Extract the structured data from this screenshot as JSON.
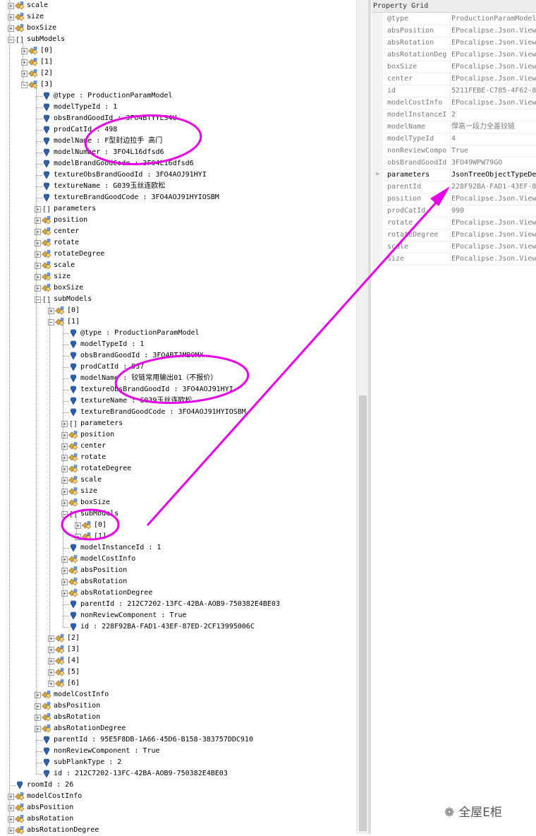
{
  "tree_rows": [
    {
      "d": 0,
      "exp": "+",
      "icon": "obj",
      "t": "scale"
    },
    {
      "d": 0,
      "exp": "+",
      "icon": "obj",
      "t": "size"
    },
    {
      "d": 0,
      "exp": "+",
      "icon": "obj",
      "t": "boxSize"
    },
    {
      "d": 0,
      "exp": "-",
      "icon": "arr",
      "t": "subModels"
    },
    {
      "d": 1,
      "exp": "+",
      "icon": "obj",
      "t": "[0]"
    },
    {
      "d": 1,
      "exp": "+",
      "icon": "obj",
      "t": "[1]"
    },
    {
      "d": 1,
      "exp": "+",
      "icon": "obj",
      "t": "[2]"
    },
    {
      "d": 1,
      "exp": "-",
      "icon": "obj",
      "t": "[3]"
    },
    {
      "d": 2,
      "exp": "",
      "icon": "val",
      "t": "@type : ProductionParamModel"
    },
    {
      "d": 2,
      "exp": "",
      "icon": "val",
      "t": "modelTypeId : 1"
    },
    {
      "d": 2,
      "exp": "",
      "icon": "val",
      "t": "obsBrandGoodId : 3FO4BTYYLS4U"
    },
    {
      "d": 2,
      "exp": "",
      "icon": "val",
      "t": "prodCatId : 498"
    },
    {
      "d": 2,
      "exp": "",
      "icon": "val",
      "t": "modelName : F型封边拉手 高门"
    },
    {
      "d": 2,
      "exp": "",
      "icon": "val",
      "t": "modelNumber : 3FO4L16dfsd6"
    },
    {
      "d": 2,
      "exp": "",
      "icon": "val",
      "t": "modelBrandGoodCode : 3FO4L16dfsd6"
    },
    {
      "d": 2,
      "exp": "",
      "icon": "val",
      "t": "textureObsBrandGoodId : 3FO4AOJ91HYI"
    },
    {
      "d": 2,
      "exp": "",
      "icon": "val",
      "t": "textureName : G039玉丝连欧松"
    },
    {
      "d": 2,
      "exp": "",
      "icon": "val",
      "t": "textureBrandGoodCode : 3FO4AOJ91HYIOSBM"
    },
    {
      "d": 2,
      "exp": "+",
      "icon": "arr",
      "t": "parameters"
    },
    {
      "d": 2,
      "exp": "+",
      "icon": "obj",
      "t": "position"
    },
    {
      "d": 2,
      "exp": "+",
      "icon": "obj",
      "t": "center"
    },
    {
      "d": 2,
      "exp": "+",
      "icon": "obj",
      "t": "rotate"
    },
    {
      "d": 2,
      "exp": "+",
      "icon": "obj",
      "t": "rotateDegree"
    },
    {
      "d": 2,
      "exp": "+",
      "icon": "obj",
      "t": "scale"
    },
    {
      "d": 2,
      "exp": "+",
      "icon": "obj",
      "t": "size"
    },
    {
      "d": 2,
      "exp": "+",
      "icon": "obj",
      "t": "boxSize"
    },
    {
      "d": 2,
      "exp": "-",
      "icon": "arr",
      "t": "subModels"
    },
    {
      "d": 3,
      "exp": "+",
      "icon": "obj",
      "t": "[0]"
    },
    {
      "d": 3,
      "exp": "-",
      "icon": "obj",
      "t": "[1]"
    },
    {
      "d": 4,
      "exp": "",
      "icon": "val",
      "t": "@type : ProductionParamModel"
    },
    {
      "d": 4,
      "exp": "",
      "icon": "val",
      "t": "modelTypeId : 1"
    },
    {
      "d": 4,
      "exp": "",
      "icon": "val",
      "t": "obsBrandGoodId : 3FO4BTJMBOMX"
    },
    {
      "d": 4,
      "exp": "",
      "icon": "val",
      "t": "prodCatId : 957"
    },
    {
      "d": 4,
      "exp": "",
      "icon": "val",
      "t": "modelName : 铰链常用输出01（不报价）"
    },
    {
      "d": 4,
      "exp": "",
      "icon": "val",
      "t": "textureObsBrandGoodId : 3FO4AOJ91HYI"
    },
    {
      "d": 4,
      "exp": "",
      "icon": "val",
      "t": "textureName : G039玉丝连欧松"
    },
    {
      "d": 4,
      "exp": "",
      "icon": "val",
      "t": "textureBrandGoodCode : 3FO4AOJ91HYIOSBM"
    },
    {
      "d": 4,
      "exp": "+",
      "icon": "arr",
      "t": "parameters"
    },
    {
      "d": 4,
      "exp": "+",
      "icon": "obj",
      "t": "position"
    },
    {
      "d": 4,
      "exp": "+",
      "icon": "obj",
      "t": "center"
    },
    {
      "d": 4,
      "exp": "+",
      "icon": "obj",
      "t": "rotate"
    },
    {
      "d": 4,
      "exp": "+",
      "icon": "obj",
      "t": "rotateDegree"
    },
    {
      "d": 4,
      "exp": "+",
      "icon": "obj",
      "t": "scale"
    },
    {
      "d": 4,
      "exp": "+",
      "icon": "obj",
      "t": "size"
    },
    {
      "d": 4,
      "exp": "+",
      "icon": "obj",
      "t": "boxSize"
    },
    {
      "d": 4,
      "exp": "-",
      "icon": "arr",
      "t": "subModels"
    },
    {
      "d": 5,
      "exp": "+",
      "icon": "obj",
      "t": "[0]"
    },
    {
      "d": 5,
      "exp": "+",
      "icon": "obj",
      "t": "[1]"
    },
    {
      "d": 4,
      "exp": "",
      "icon": "val",
      "t": "modelInstanceId : 1"
    },
    {
      "d": 4,
      "exp": "+",
      "icon": "obj",
      "t": "modelCostInfo"
    },
    {
      "d": 4,
      "exp": "+",
      "icon": "obj",
      "t": "absPosition"
    },
    {
      "d": 4,
      "exp": "+",
      "icon": "obj",
      "t": "absRotation"
    },
    {
      "d": 4,
      "exp": "+",
      "icon": "obj",
      "t": "absRotationDegree"
    },
    {
      "d": 4,
      "exp": "",
      "icon": "val",
      "t": "parentId : 212C7202-13FC-42BA-AOB9-750382E4BE03"
    },
    {
      "d": 4,
      "exp": "",
      "icon": "val",
      "t": "nonReviewComponent : True"
    },
    {
      "d": 4,
      "exp": "",
      "icon": "val",
      "t": "id : 228F92BA-FAD1-43EF-87ED-2CF13995006C"
    },
    {
      "d": 3,
      "exp": "+",
      "icon": "obj",
      "t": "[2]"
    },
    {
      "d": 3,
      "exp": "+",
      "icon": "obj",
      "t": "[3]"
    },
    {
      "d": 3,
      "exp": "+",
      "icon": "obj",
      "t": "[4]"
    },
    {
      "d": 3,
      "exp": "+",
      "icon": "obj",
      "t": "[5]"
    },
    {
      "d": 3,
      "exp": "+",
      "icon": "obj",
      "t": "[6]"
    },
    {
      "d": 2,
      "exp": "+",
      "icon": "obj",
      "t": "modelCostInfo"
    },
    {
      "d": 2,
      "exp": "+",
      "icon": "obj",
      "t": "absPosition"
    },
    {
      "d": 2,
      "exp": "+",
      "icon": "obj",
      "t": "absRotation"
    },
    {
      "d": 2,
      "exp": "+",
      "icon": "obj",
      "t": "absRotationDegree"
    },
    {
      "d": 2,
      "exp": "",
      "icon": "val",
      "t": "parentId : 95E5F8DB-1A66-45D6-B158-383757DDC910"
    },
    {
      "d": 2,
      "exp": "",
      "icon": "val",
      "t": "nonReviewComponent : True"
    },
    {
      "d": 2,
      "exp": "",
      "icon": "val",
      "t": "subPlankType : 2"
    },
    {
      "d": 2,
      "exp": "",
      "icon": "val",
      "t": "id : 212C7202-13FC-42BA-AOB9-750382E4BE03"
    },
    {
      "d": 0,
      "exp": "",
      "icon": "val",
      "t": "roomId : 26"
    },
    {
      "d": 0,
      "exp": "+",
      "icon": "obj",
      "t": "modelCostInfo"
    },
    {
      "d": 0,
      "exp": "+",
      "icon": "obj",
      "t": "absPosition"
    },
    {
      "d": 0,
      "exp": "+",
      "icon": "obj",
      "t": "absRotation"
    },
    {
      "d": 0,
      "exp": "+",
      "icon": "obj",
      "t": "absRotationDegree"
    }
  ],
  "property_grid": {
    "title": "Property Grid",
    "rows": [
      {
        "k": "@type",
        "v": "ProductionParamModel",
        "bold": false,
        "exp": ""
      },
      {
        "k": "absPosition",
        "v": "EPocalipse.Json.Viewer",
        "bold": false,
        "exp": ""
      },
      {
        "k": "absRotation",
        "v": "EPocalipse.Json.Viewer",
        "bold": false,
        "exp": ""
      },
      {
        "k": "absRotationDeg",
        "v": "EPocalipse.Json.Viewer",
        "bold": false,
        "exp": ""
      },
      {
        "k": "boxSize",
        "v": "EPocalipse.Json.Viewer",
        "bold": false,
        "exp": ""
      },
      {
        "k": "center",
        "v": "EPocalipse.Json.Viewer",
        "bold": false,
        "exp": ""
      },
      {
        "k": "id",
        "v": "5211FEBE-C785-4F62-8",
        "bold": false,
        "exp": ""
      },
      {
        "k": "modelCostInfo",
        "v": "EPocalipse.Json.Viewer",
        "bold": false,
        "exp": ""
      },
      {
        "k": "modelInstanceI",
        "v": "2",
        "bold": false,
        "exp": ""
      },
      {
        "k": "modelName",
        "v": "悍高一段力全盖铰链",
        "bold": false,
        "exp": ""
      },
      {
        "k": "modelTypeId",
        "v": "4",
        "bold": false,
        "exp": ""
      },
      {
        "k": "nonReviewCompo",
        "v": "True",
        "bold": false,
        "exp": ""
      },
      {
        "k": "obsBrandGoodId",
        "v": "3FO49WPW79GO",
        "bold": false,
        "exp": ""
      },
      {
        "k": "parameters",
        "v": "JsonTreeObjectTypeDe",
        "bold": true,
        "exp": ">"
      },
      {
        "k": "parentId",
        "v": "228F92BA-FAD1-43EF-8",
        "bold": false,
        "exp": ""
      },
      {
        "k": "position",
        "v": "EPocalipse.Json.Viewer",
        "bold": false,
        "exp": ""
      },
      {
        "k": "prodCatId",
        "v": "990",
        "bold": false,
        "exp": ""
      },
      {
        "k": "rotate",
        "v": "EPocalipse.Json.Viewer",
        "bold": false,
        "exp": ""
      },
      {
        "k": "rotateDegree",
        "v": "EPocalipse.Json.Viewer",
        "bold": false,
        "exp": ""
      },
      {
        "k": "scale",
        "v": "EPocalipse.Json.Viewer",
        "bold": false,
        "exp": ""
      },
      {
        "k": "size",
        "v": "EPocalipse.Json.Viewer",
        "bold": false,
        "exp": ""
      }
    ]
  },
  "watermark": {
    "icon": "wechat-icon",
    "text": "全屋E柜"
  },
  "colors": {
    "annotation": "#e800e8",
    "value_icon": "#2d5fb0",
    "object_icon": "#d9a441"
  }
}
